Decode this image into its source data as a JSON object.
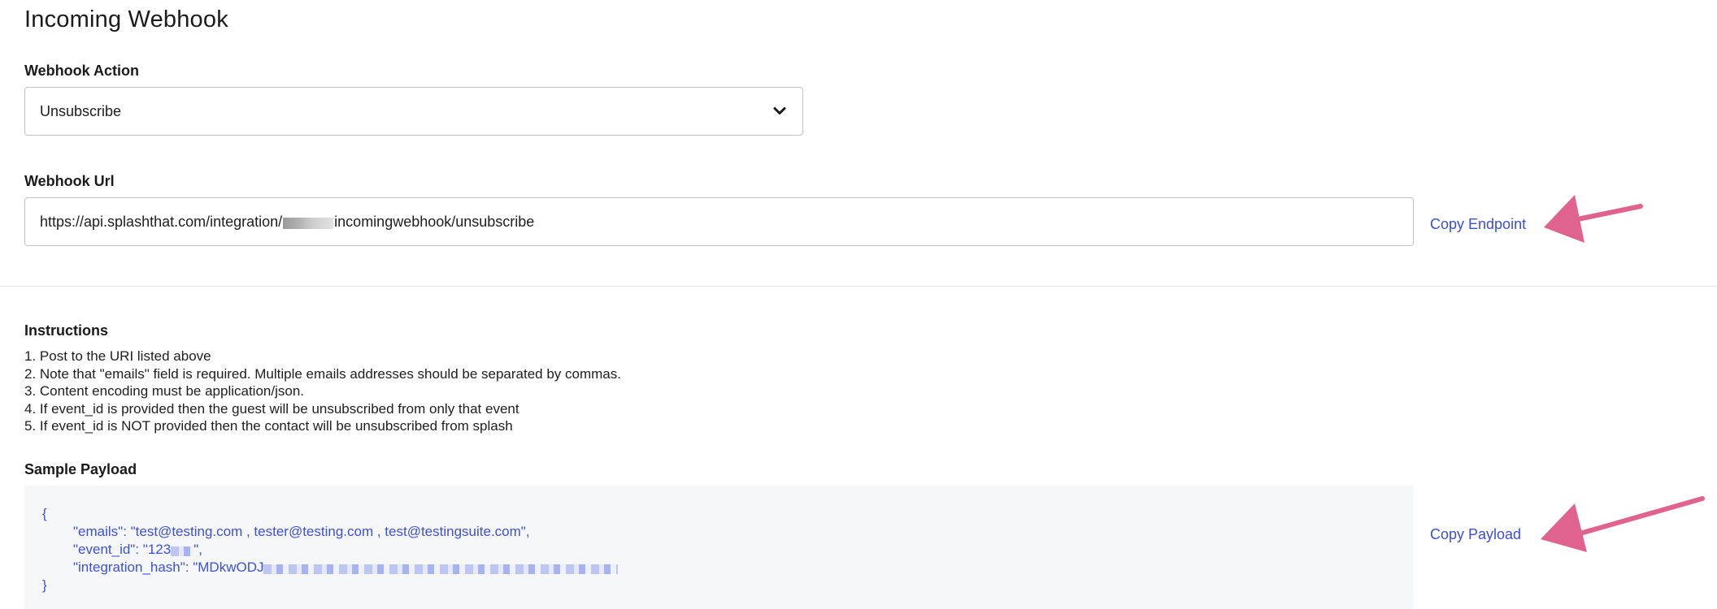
{
  "page": {
    "title": "Incoming Webhook"
  },
  "webhook_action": {
    "label": "Webhook Action",
    "selected": "Unsubscribe",
    "icon": "chevron-down-icon"
  },
  "webhook_url": {
    "label": "Webhook Url",
    "prefix": "https://api.splashthat.com/integration/",
    "suffix": "incomingwebhook/unsubscribe",
    "copy_label": "Copy Endpoint"
  },
  "instructions": {
    "heading": "Instructions",
    "items": [
      "1. Post to the URI listed above",
      "2. Note that \"emails\" field is required. Multiple emails addresses should be separated by commas.",
      "3. Content encoding must be application/json.",
      "4. If event_id is provided then the guest will be unsubscribed from only that event",
      "5. If event_id is NOT provided then the contact will be unsubscribed from splash"
    ]
  },
  "sample_payload": {
    "heading": "Sample Payload",
    "open_brace": "{",
    "line_emails": "\"emails\": \"test@testing.com , tester@testing.com , test@testingsuite.com\",",
    "line_event_id_prefix": "\"event_id\": \"123",
    "line_event_id_suffix": "\",",
    "line_hash_prefix": "\"integration_hash\": \"MDkwODJ",
    "close_brace": "}",
    "copy_label": "Copy Payload"
  },
  "colors": {
    "link": "#3a4fd6",
    "code": "#3d51d8",
    "arrow": "#e0628e",
    "payload_bg": "#f6f7f8"
  }
}
